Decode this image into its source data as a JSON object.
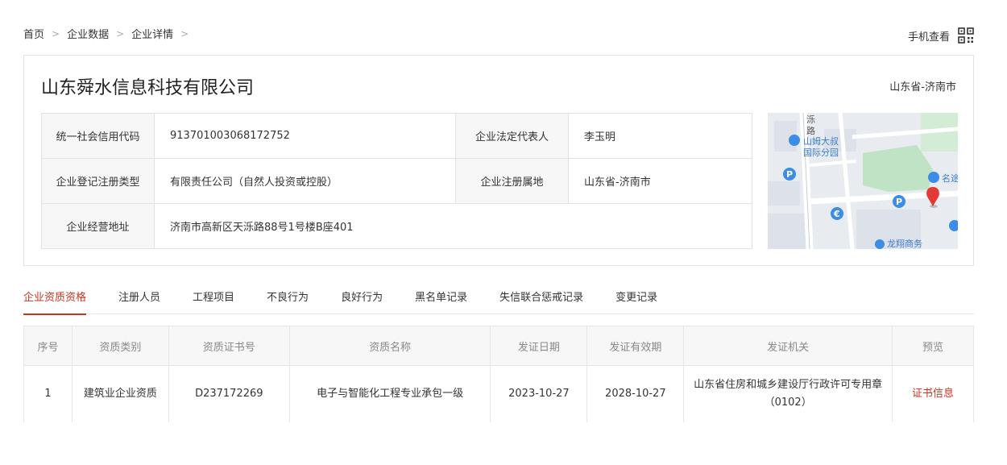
{
  "breadcrumb": {
    "items": [
      "首页",
      "企业数据",
      "企业详情"
    ]
  },
  "mobile_view": {
    "label": "手机查看"
  },
  "company": {
    "name": "山东舜水信息科技有限公司",
    "region": "山东省-济南市"
  },
  "info": {
    "credit_code_label": "统一社会信用代码",
    "credit_code": "913701003068172752",
    "legal_rep_label": "企业法定代表人",
    "legal_rep": "李玉明",
    "reg_type_label": "企业登记注册类型",
    "reg_type": "有限责任公司（自然人投资或控股）",
    "reg_place_label": "企业注册属地",
    "reg_place": "山东省-济南市",
    "address_label": "企业经营地址",
    "address": "济南市高新区天泺路88号1号楼B座401"
  },
  "map": {
    "labels": [
      "泺",
      "路",
      "山姆大叔",
      "国际分园",
      "名途",
      "龙翔商务"
    ]
  },
  "tabs": [
    "企业资质资格",
    "注册人员",
    "工程项目",
    "不良行为",
    "良好行为",
    "黑名单记录",
    "失信联合惩戒记录",
    "变更记录"
  ],
  "qualifications": {
    "headers": [
      "序号",
      "资质类别",
      "资质证书号",
      "资质名称",
      "发证日期",
      "发证有效期",
      "发证机关",
      "预览"
    ],
    "rows": [
      {
        "index": "1",
        "category": "建筑业企业资质",
        "cert_no": "D237172269",
        "name": "电子与智能化工程专业承包一级",
        "issue_date": "2023-10-27",
        "valid_until": "2028-10-27",
        "authority": "山东省住房和城乡建设厅行政许可专用章（0102）",
        "preview": "证书信息"
      }
    ]
  },
  "colors": {
    "accent": "#c8341f",
    "border": "#e2e2e2",
    "label_bg": "#f7f7f7"
  }
}
